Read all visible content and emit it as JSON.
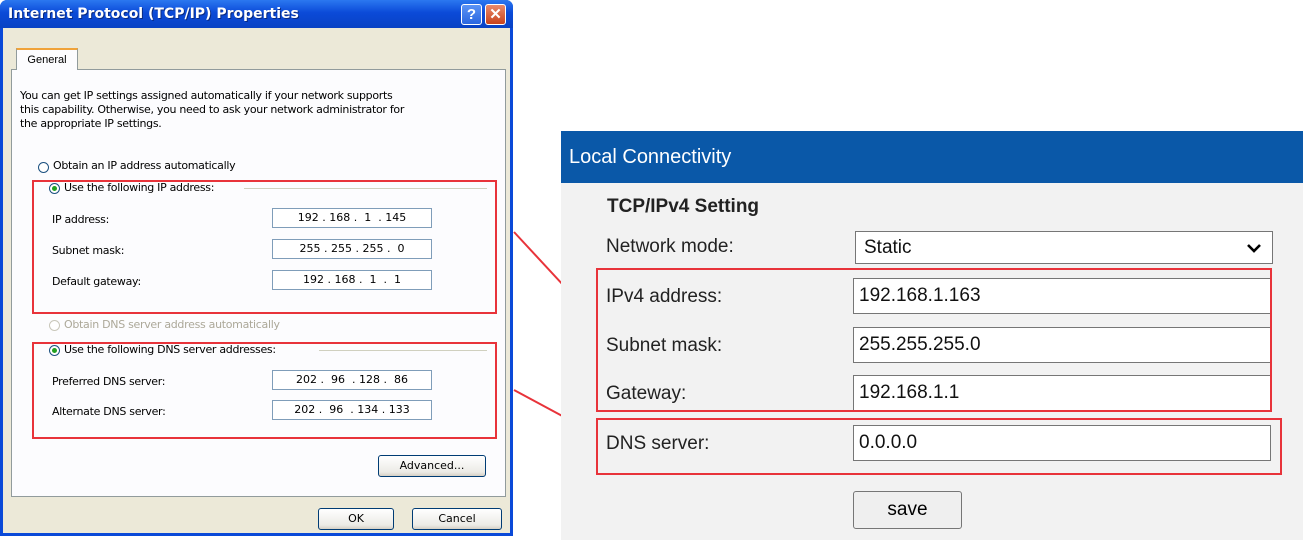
{
  "dialog": {
    "title": "Internet Protocol (TCP/IP) Properties",
    "help_label": "?",
    "close_label": "✕",
    "tab_general": "General",
    "description": [
      "You can get IP settings assigned automatically if your network supports",
      "this capability. Otherwise, you need to ask your network administrator for",
      "the appropriate IP settings."
    ],
    "radio_auto_ip": "Obtain an IP address automatically",
    "radio_static_ip": "Use the following IP address:",
    "ip_label": "IP address:",
    "ip_value": "192 . 168 .  1  . 145",
    "subnet_label": "Subnet mask:",
    "subnet_value": "255 . 255 . 255 .  0",
    "gateway_label": "Default gateway:",
    "gateway_value": "192 . 168 .  1  .  1",
    "radio_auto_dns": "Obtain DNS server address automatically",
    "radio_static_dns": "Use the following DNS server addresses:",
    "pref_dns_label": "Preferred DNS server:",
    "pref_dns_value": "202 .  96  . 128 .  86",
    "alt_dns_label": "Alternate DNS server:",
    "alt_dns_value": "202 .  96  . 134 . 133",
    "advanced_label": "Advanced...",
    "ok_label": "OK",
    "cancel_label": "Cancel"
  },
  "web": {
    "header": "Local Connectivity",
    "section_title": "TCP/IPv4 Setting",
    "mode_label": "Network mode:",
    "mode_value": "Static",
    "ipv4_label": "IPv4 address:",
    "ipv4_value": "192.168.1.163",
    "subnet_label": "Subnet mask:",
    "subnet_value": "255.255.255.0",
    "gateway_label": "Gateway:",
    "gateway_value": "192.168.1.1",
    "dns_label": "DNS server:",
    "dns_value": "0.0.0.0",
    "save_label": "save"
  },
  "colors": {
    "highlight": "#e8333a",
    "header_blue": "#0a58a8",
    "xp_blue": "#0a49d8"
  }
}
